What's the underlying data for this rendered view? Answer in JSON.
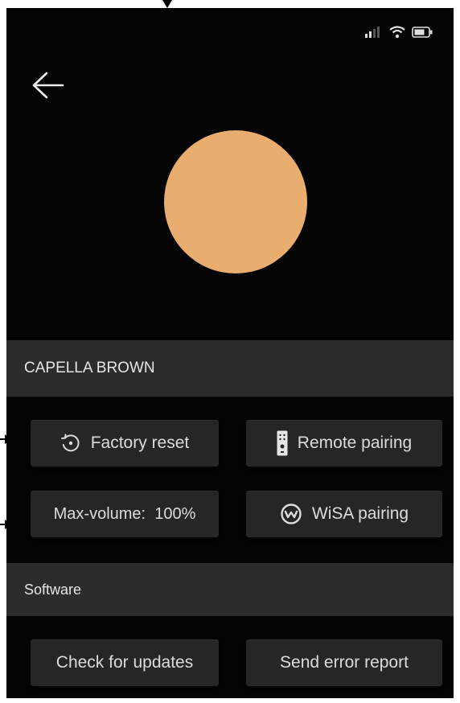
{
  "colors": {
    "background": "#040404",
    "section_header": "#2c2c2c",
    "button": "#262626",
    "text": "#dcdcdc",
    "speaker_color": "#e8ad6f"
  },
  "status_bar": {
    "icons": [
      "signal-icon",
      "wifi-icon",
      "battery-icon"
    ]
  },
  "header": {
    "back_icon": "arrow-left-icon"
  },
  "device_section": {
    "title": "CAPELLA BROWN",
    "buttons": {
      "factory_reset": "Factory reset",
      "remote_pairing": "Remote pairing",
      "max_volume": "Max-volume:  100%",
      "wisa_pairing": "WiSA pairing"
    }
  },
  "software_section": {
    "title": "Software",
    "buttons": {
      "check_updates": "Check for updates",
      "send_error_report": "Send error report"
    }
  }
}
